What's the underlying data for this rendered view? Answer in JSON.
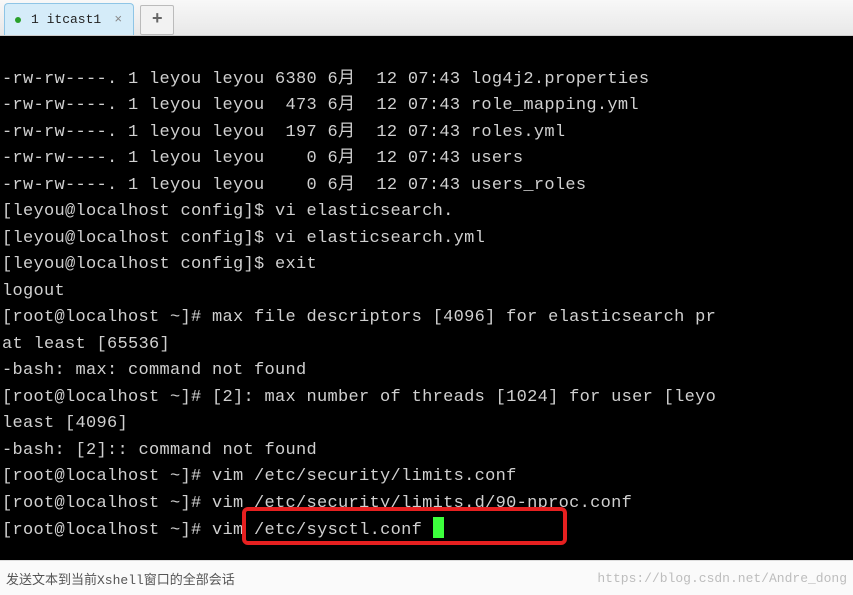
{
  "tab": {
    "label": "1 itcast1",
    "close_glyph": "×",
    "add_glyph": "+"
  },
  "terminal": {
    "line01": "-rw-rw----. 1 leyou leyou 6380 6月  12 07:43 log4j2.properties",
    "line02": "-rw-rw----. 1 leyou leyou  473 6月  12 07:43 role_mapping.yml",
    "line03": "-rw-rw----. 1 leyou leyou  197 6月  12 07:43 roles.yml",
    "line04": "-rw-rw----. 1 leyou leyou    0 6月  12 07:43 users",
    "line05": "-rw-rw----. 1 leyou leyou    0 6月  12 07:43 users_roles",
    "line06": "[leyou@localhost config]$ vi elasticsearch.",
    "line07": "[leyou@localhost config]$ vi elasticsearch.yml",
    "line08": "[leyou@localhost config]$ exit",
    "line09": "logout",
    "line10": "[root@localhost ~]# max file descriptors [4096] for elasticsearch pr",
    "line11": "at least [65536]",
    "line12": "-bash: max: command not found",
    "line13": "[root@localhost ~]# [2]: max number of threads [1024] for user [leyo",
    "line14": "least [4096]",
    "line15": "-bash: [2]:: command not found",
    "line16": "[root@localhost ~]# vim /etc/security/limits.conf",
    "line17": "[root@localhost ~]# vim /etc/security/limits.d/90-nproc.conf",
    "line18_prompt": "[root@localhost ~]# ",
    "line18_cmd": "vim /etc/sysctl.conf "
  },
  "status": {
    "left": "发送文本到当前Xshell窗口的全部会话",
    "right": "https://blog.csdn.net/Andre_dong"
  }
}
